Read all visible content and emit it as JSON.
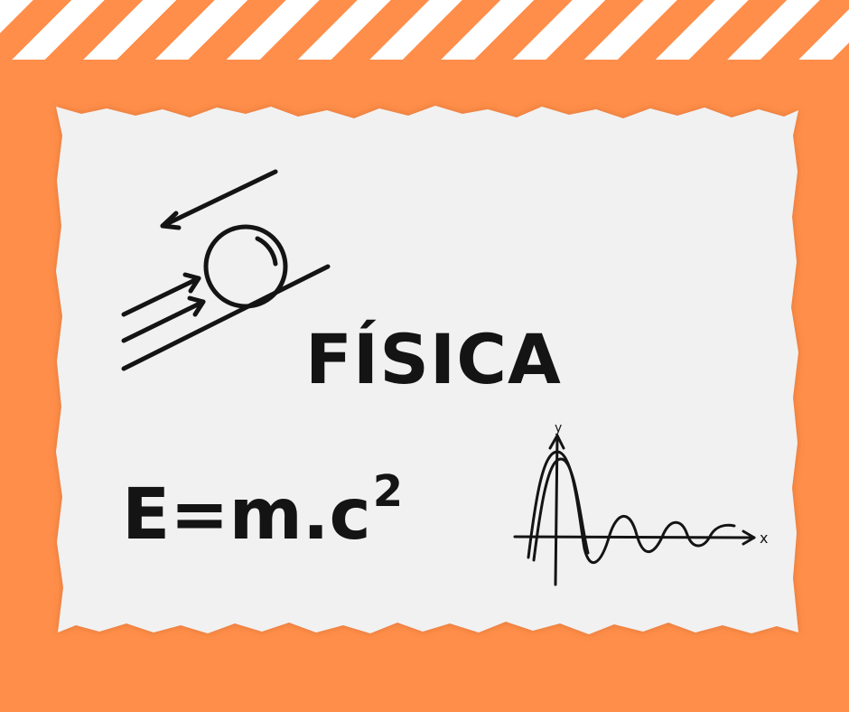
{
  "title": "FÍSICA",
  "formula": {
    "base": "E=m.c",
    "exponent": "2"
  },
  "graph": {
    "y_axis_label": "y",
    "x_axis_label": "x"
  },
  "icons": [
    "incline-ball-icon",
    "wave-graph-icon"
  ],
  "colors": {
    "background": "#ff8e4a",
    "stripe": "#ffffff",
    "paper": "#f1f1f1",
    "ink": "#141414"
  }
}
